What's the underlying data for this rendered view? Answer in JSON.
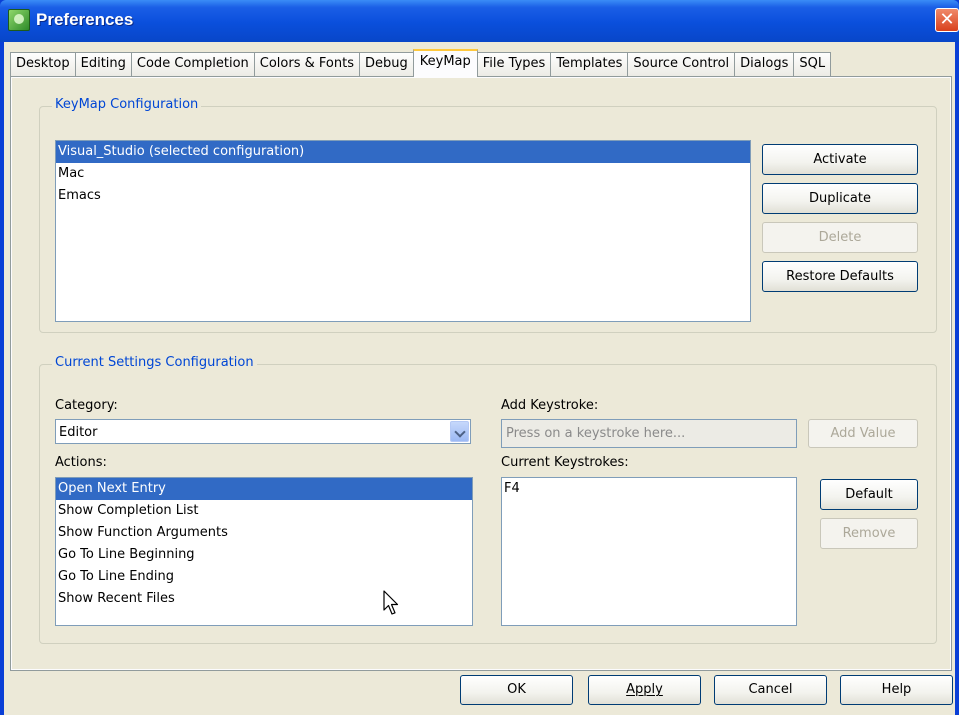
{
  "window": {
    "title": "Preferences",
    "close_glyph": "✕"
  },
  "tabs": [
    {
      "label": "Desktop"
    },
    {
      "label": "Editing"
    },
    {
      "label": "Code Completion"
    },
    {
      "label": "Colors & Fonts"
    },
    {
      "label": "Debug"
    },
    {
      "label": "KeyMap",
      "active": true
    },
    {
      "label": "File Types"
    },
    {
      "label": "Templates"
    },
    {
      "label": "Source Control"
    },
    {
      "label": "Dialogs"
    },
    {
      "label": "SQL"
    }
  ],
  "keymap_group": {
    "title": "KeyMap Configuration",
    "configurations": [
      {
        "label": "Visual_Studio (selected configuration)",
        "selected": true
      },
      {
        "label": "Mac"
      },
      {
        "label": "Emacs"
      }
    ],
    "buttons": {
      "activate": "Activate",
      "duplicate": "Duplicate",
      "delete": "Delete",
      "restore": "Restore Defaults"
    }
  },
  "settings_group": {
    "title": "Current Settings Configuration",
    "category_label": "Category:",
    "category_value": "Editor",
    "actions_label": "Actions:",
    "actions": [
      {
        "label": "Open Next Entry",
        "selected": true
      },
      {
        "label": "Show Completion List"
      },
      {
        "label": "Show Function Arguments"
      },
      {
        "label": "Go To Line Beginning"
      },
      {
        "label": "Go To Line Ending"
      },
      {
        "label": "Show Recent Files"
      }
    ],
    "add_keystroke_label": "Add Keystroke:",
    "keystroke_placeholder": "Press on a keystroke here...",
    "add_value": "Add Value",
    "current_keystrokes_label": "Current Keystrokes:",
    "current_keystrokes": [
      "F4"
    ],
    "default": "Default",
    "remove": "Remove"
  },
  "footer": {
    "ok": "OK",
    "apply": "Apply",
    "cancel": "Cancel",
    "help": "Help"
  },
  "colors": {
    "title_bar": "#0a4fdc",
    "selection": "#316ac5",
    "group_title": "#0046d5",
    "dialog_bg": "#ece9d8"
  }
}
